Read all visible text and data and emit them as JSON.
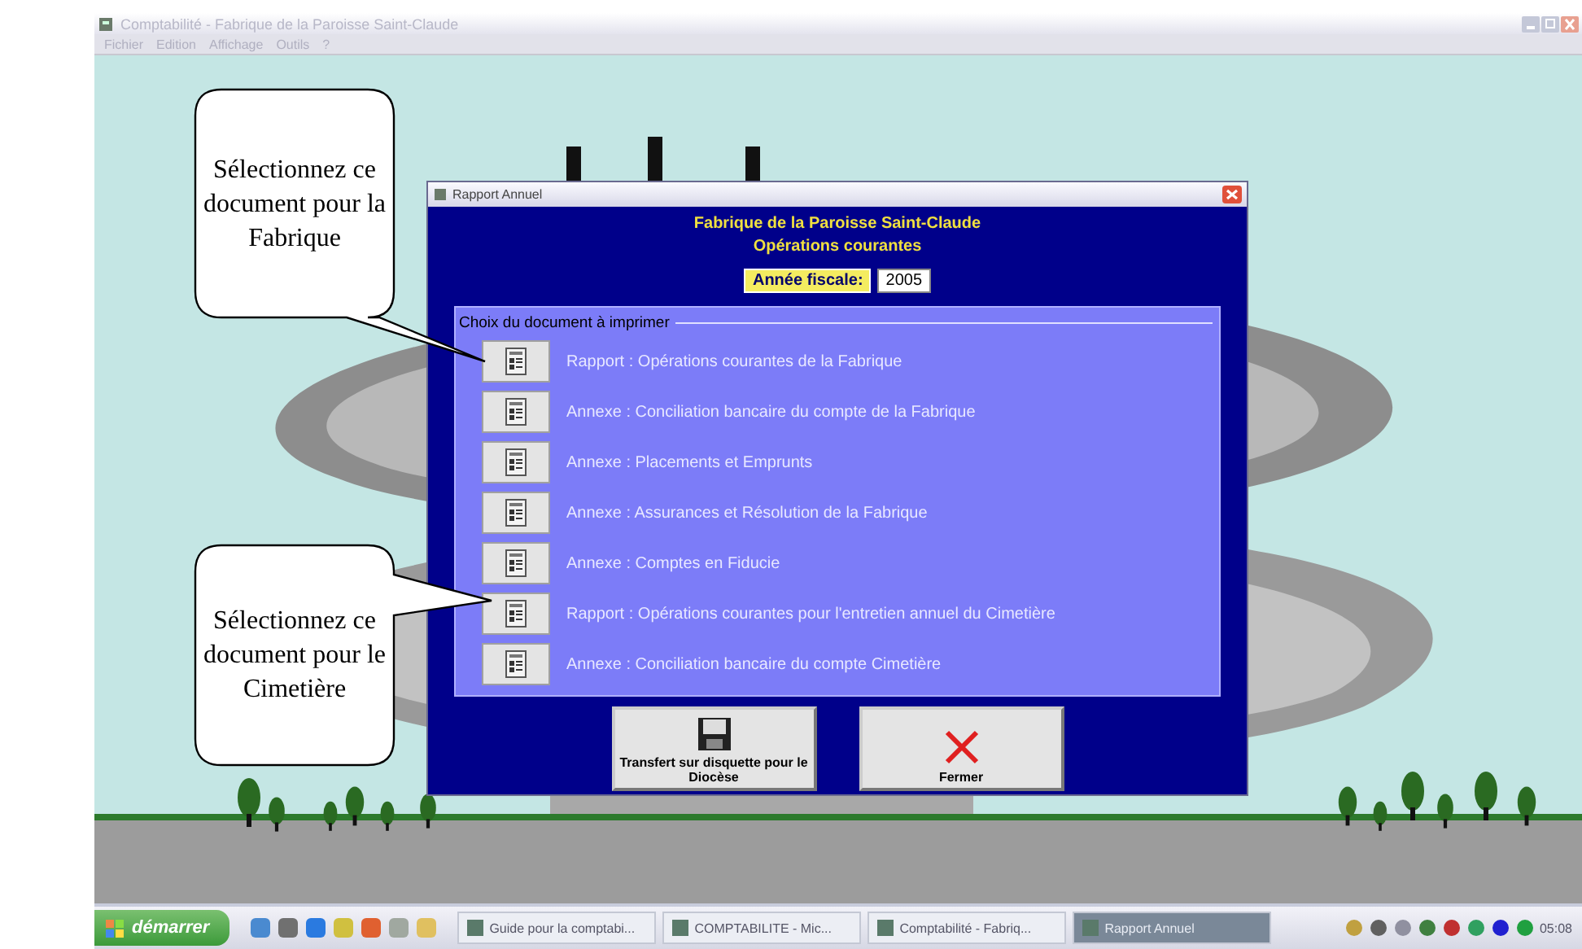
{
  "window": {
    "title": "Comptabilité - Fabrique de la Paroisse Saint-Claude",
    "menu": [
      "Fichier",
      "Edition",
      "Affichage",
      "Outils",
      "?"
    ]
  },
  "dialog": {
    "title": "Rapport Annuel",
    "heading": [
      "Fabrique de la Paroisse Saint-Claude",
      "Opérations courantes"
    ],
    "fiscal_year": {
      "label": "Année fiscale:",
      "value": "2005"
    },
    "group": {
      "title": "Choix du document à imprimer",
      "documents": [
        {
          "label": "Rapport : Opérations courantes de la Fabrique"
        },
        {
          "label": "Annexe : Conciliation bancaire du compte de la Fabrique"
        },
        {
          "label": "Annexe : Placements et Emprunts"
        },
        {
          "label": "Annexe : Assurances et Résolution de la Fabrique"
        },
        {
          "label": "Annexe : Comptes en Fiducie"
        },
        {
          "label": "Rapport : Opérations courantes pour l'entretien annuel du Cimetière"
        },
        {
          "label": "Annexe : Conciliation bancaire du compte Cimetière"
        }
      ]
    },
    "buttons": [
      {
        "kind": "floppy",
        "label": "Transfert sur disquette pour le Diocèse"
      },
      {
        "kind": "close",
        "label": "Fermer"
      }
    ]
  },
  "callouts": [
    {
      "text": "Sélectionnez ce document pour la Fabrique"
    },
    {
      "text": "Sélectionnez ce document pour le Cimetière"
    }
  ],
  "taskbar": {
    "start": "démarrer",
    "tasks": [
      {
        "label": "Guide pour la comptabi...",
        "selected": false
      },
      {
        "label": "COMPTABILITE - Mic...",
        "selected": false
      },
      {
        "label": "Comptabilité - Fabriq...",
        "selected": false
      },
      {
        "label": "Rapport Annuel",
        "selected": true
      }
    ],
    "clock": "05:08"
  }
}
